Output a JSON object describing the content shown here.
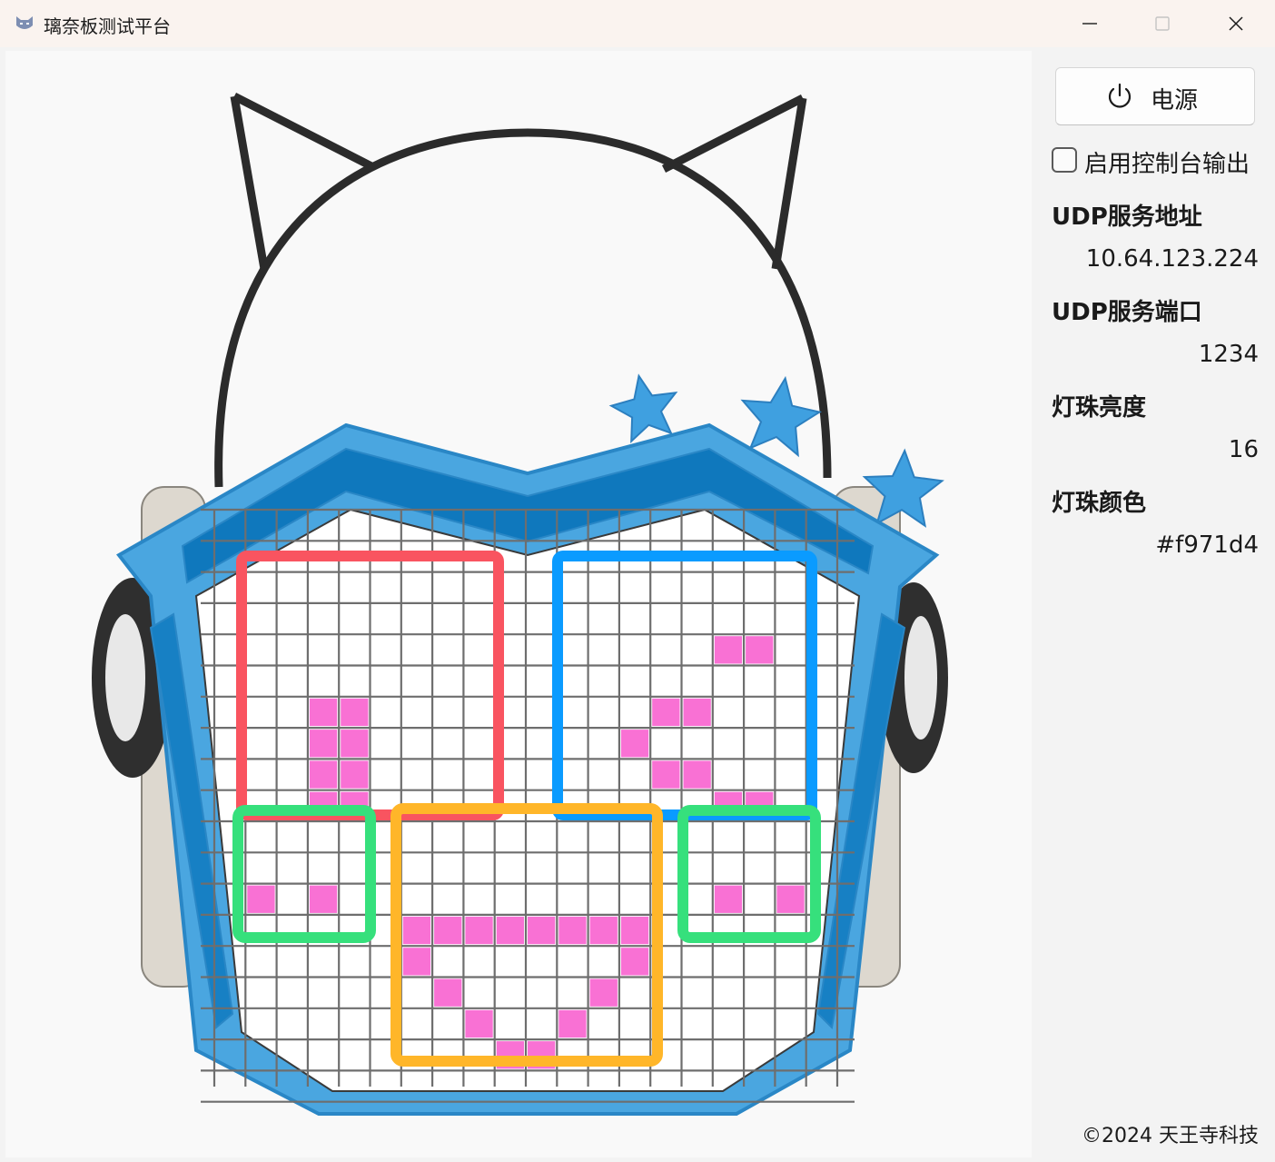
{
  "window": {
    "title": "璃奈板测试平台",
    "app_icon": "cat-face-icon",
    "controls": [
      "minimize-icon",
      "maximize-icon",
      "close-icon"
    ]
  },
  "preview": {
    "description_icon": "rina-board-mask-illustration",
    "led_color": "#f971d4",
    "region_colors": {
      "left_eye": "#f95460",
      "right_eye": "#0a9bff",
      "cheeks": "#36e07c",
      "mouth": "#ffb629"
    }
  },
  "sidebar": {
    "power_label": "电源",
    "power_icon": "power-icon",
    "console_checkbox_label": "启用控制台输出",
    "console_checked": false,
    "fields": [
      {
        "label": "UDP服务地址",
        "value": "10.64.123.224"
      },
      {
        "label": "UDP服务端口",
        "value": "1234"
      },
      {
        "label": "灯珠亮度",
        "value": "16"
      },
      {
        "label": "灯珠颜色",
        "value": "#f971d4"
      }
    ],
    "copyright": "©2024 天王寺科技"
  }
}
